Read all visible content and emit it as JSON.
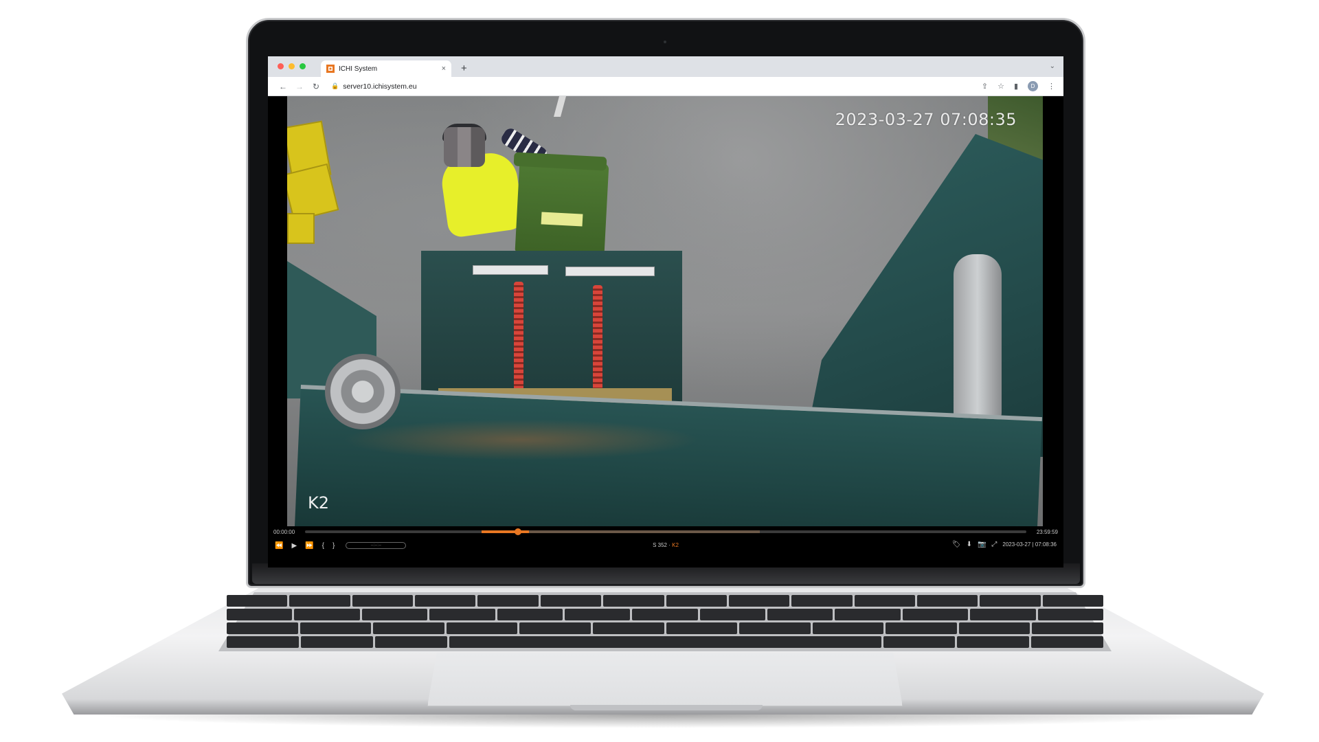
{
  "browser": {
    "tab_title": "ICHI System",
    "tab_close": "×",
    "new_tab": "+",
    "tab_menu": "⌄",
    "url": "server10.ichisystem.eu",
    "nav_back": "←",
    "nav_forward": "→",
    "nav_reload": "↻",
    "lock": "🔒",
    "share": "⇪",
    "star": "☆",
    "sidepanel": "▮",
    "profile_initial": "D",
    "menu": "⋮",
    "traffic_colors": [
      "#fe5f57",
      "#febc2e",
      "#28c840"
    ]
  },
  "video": {
    "timestamp": "2023-03-27 07:08:35",
    "camera_label": "K2"
  },
  "player": {
    "time_start": "00:00:00",
    "time_end": "23:59:59",
    "progress_fraction": 0.295,
    "recorded_range": [
      0.245,
      0.63
    ],
    "buffered_range": [
      0.245,
      0.31
    ],
    "rewind": "⏪",
    "play": "▶",
    "forward": "⏩",
    "mark_in": "{",
    "mark_out": "}",
    "speed_placeholder": "--:--:--",
    "vehicle": "S 352",
    "separator": " · ",
    "camera": "K2",
    "tag_icon": "🏷",
    "download_icon": "⬇",
    "snapshot_icon": "📷",
    "fullscreen_icon": "⤢",
    "current_datetime": "2023-03-27 | 07:08:36",
    "accent_color": "#e87722"
  }
}
